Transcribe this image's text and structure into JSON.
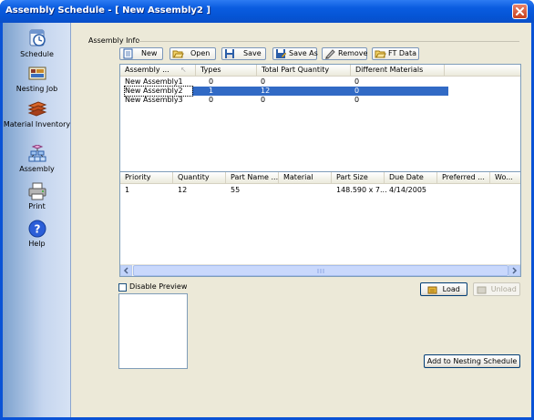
{
  "window": {
    "title": "Assembly Schedule - [ New Assembly2 ]"
  },
  "sidebar": {
    "items": [
      {
        "label": "Schedule",
        "icon": "schedule-icon"
      },
      {
        "label": "Nesting Job",
        "icon": "nesting-job-icon"
      },
      {
        "label": "Material Inventory",
        "icon": "material-inventory-icon"
      },
      {
        "label": "Assembly",
        "icon": "assembly-icon"
      },
      {
        "label": "Print",
        "icon": "print-icon"
      },
      {
        "label": "Help",
        "icon": "help-icon"
      }
    ]
  },
  "assembly_info": {
    "label": "Assembly Info"
  },
  "toolbar": {
    "new": "New",
    "open": "Open",
    "save": "Save",
    "save_as": "Save As",
    "remove": "Remove",
    "ft_data": "FT Data"
  },
  "assemblies": {
    "columns": [
      "Assembly ...",
      "Types",
      "Total Part Quantity",
      "Different Materials"
    ],
    "rows": [
      {
        "name": "New Assembly1",
        "types": "0",
        "total": "0",
        "materials": "0",
        "selected": false
      },
      {
        "name": "New Assembly2",
        "types": "1",
        "total": "12",
        "materials": "0",
        "selected": true
      },
      {
        "name": "New Assembly3",
        "types": "0",
        "total": "0",
        "materials": "0",
        "selected": false
      }
    ]
  },
  "parts": {
    "columns": [
      "Priority",
      "Quantity",
      "Part Name ...",
      "Material",
      "Part Size",
      "Due Date",
      "Preferred ...",
      "Wo..."
    ],
    "rows": [
      {
        "priority": "1",
        "quantity": "12",
        "part_name": "55",
        "material": "",
        "part_size": "148.590 x 7...",
        "due_date": "4/14/2005",
        "preferred": "",
        "wo": ""
      }
    ]
  },
  "preview": {
    "disable_label": "Disable Preview",
    "checked": false
  },
  "buttons": {
    "load": "Load",
    "unload": "Unload",
    "add_to_nesting": "Add to Nesting Schedule"
  },
  "colors": {
    "titlebar": "#0a5ce0",
    "selection": "#316ac5",
    "client": "#ece9d8",
    "sidebar": "#c6d6ef"
  }
}
